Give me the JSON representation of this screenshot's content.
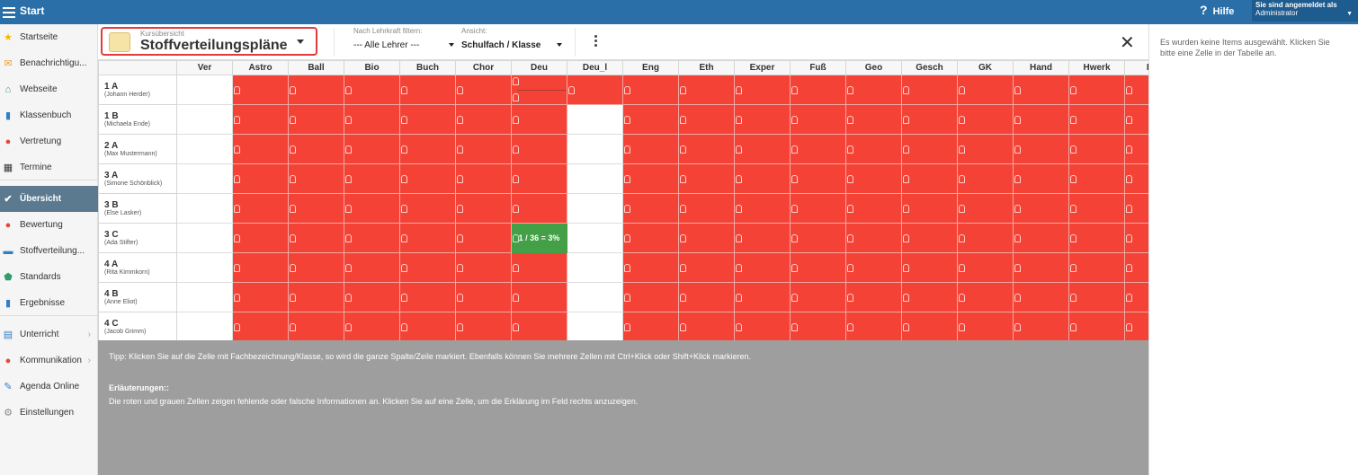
{
  "topbar": {
    "title": "Start",
    "help": "Hilfe",
    "user_label": "Sie sind angemeldet als",
    "user_name": "Administrator"
  },
  "sidebar": {
    "items": [
      {
        "label": "Startseite",
        "icon": "star-icon",
        "color": "#f5b800"
      },
      {
        "label": "Benachrichtigu...",
        "icon": "envelope-icon",
        "color": "#f0a030"
      },
      {
        "label": "Webseite",
        "icon": "home-icon",
        "color": "#2e9d6a"
      },
      {
        "label": "Klassenbuch",
        "icon": "book-icon",
        "color": "#2f7fc6"
      },
      {
        "label": "Vertretung",
        "icon": "person-icon",
        "color": "#e04a3a"
      },
      {
        "label": "Termine",
        "icon": "calendar-icon",
        "color": "#333333"
      },
      {
        "label": "Übersicht",
        "icon": "check-circle-icon",
        "color": "#ffffff"
      },
      {
        "label": "Bewertung",
        "icon": "badge-icon",
        "color": "#e04a3a"
      },
      {
        "label": "Stoffverteilung...",
        "icon": "briefcase-icon",
        "color": "#2f7fc6"
      },
      {
        "label": "Standards",
        "icon": "shield-icon",
        "color": "#2e9d6a"
      },
      {
        "label": "Ergebnisse",
        "icon": "bar-chart-icon",
        "color": "#2f7fc6"
      },
      {
        "label": "Unterricht",
        "icon": "open-book-icon",
        "color": "#2f7fc6"
      },
      {
        "label": "Kommunikation",
        "icon": "chat-icon",
        "color": "#e04a3a"
      },
      {
        "label": "Agenda Online",
        "icon": "pen-icon",
        "color": "#2f7fc6"
      },
      {
        "label": "Einstellungen",
        "icon": "gear-icon",
        "color": "#888888"
      }
    ]
  },
  "toolbar": {
    "title_sub": "Kursübersicht",
    "title": "Stoffverteilungspläne",
    "filter_label": "Nach Lehrkraft filtern:",
    "filter_value": "--- Alle Lehrer ---",
    "view_label": "Ansicht:",
    "view_value": "Schulfach / Klasse"
  },
  "grid": {
    "columns": [
      "Ver",
      "Astro",
      "Ball",
      "Bio",
      "Buch",
      "Chor",
      "Deu",
      "Deu_l",
      "Eng",
      "Eth",
      "Exper",
      "Fuß",
      "Geo",
      "Gesch",
      "GK",
      "Hand",
      "Hwerk",
      "Ho"
    ],
    "rows": [
      {
        "cls": "1 A",
        "teacher": "(Johann Herder)"
      },
      {
        "cls": "1 B",
        "teacher": "(Michaela Ende)"
      },
      {
        "cls": "2 A",
        "teacher": "(Max Mustermann)"
      },
      {
        "cls": "3 A",
        "teacher": "(Simone Schönblick)"
      },
      {
        "cls": "3 B",
        "teacher": "(Else Lasker)"
      },
      {
        "cls": "3 C",
        "teacher": "(Ada Stifter)"
      },
      {
        "cls": "4 A",
        "teacher": "(Rita Kimmkorn)"
      },
      {
        "cls": "4 B",
        "teacher": "(Anne Eliot)"
      },
      {
        "cls": "4 C",
        "teacher": "(Jacob Grimm)"
      }
    ],
    "green_cell": {
      "row": 5,
      "col": 6,
      "text": "1 / 36 = 3%"
    },
    "colors": {
      "red": "#f44336",
      "green": "#43a047"
    }
  },
  "footer": {
    "tip": "Tipp: Klicken Sie auf die Zelle mit Fachbezeichnung/Klasse, so wird die ganze Spalte/Zeile markiert. Ebenfalls können Sie mehrere Zellen mit Ctrl+Klick oder Shift+Klick markieren.",
    "explain_heading": "Erläuterungen::",
    "explain": "Die roten und grauen Zellen zeigen fehlende oder falsche Informationen an. Klicken Sie auf eine Zelle, um die Erklärung im Feld rechts anzuzeigen."
  },
  "right_panel": {
    "text": "Es wurden keine Items ausgewählt. Klicken Sie bitte eine Zelle in der Tabelle an."
  }
}
